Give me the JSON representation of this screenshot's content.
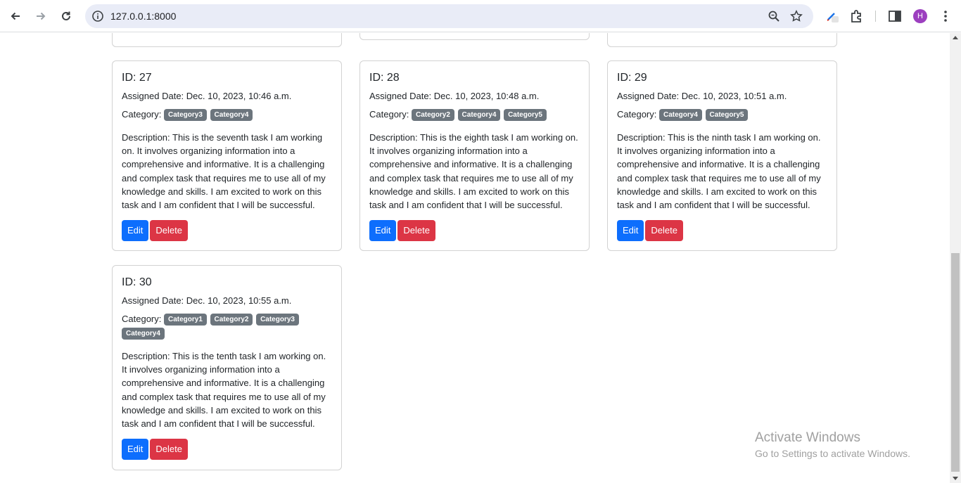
{
  "browser": {
    "url": "127.0.0.1:8000",
    "profile_initial": "H"
  },
  "cards": [
    {
      "id": "ID: 27",
      "date": "Assigned Date: Dec. 10, 2023, 10:46 a.m.",
      "category_label": "Category:",
      "categories": [
        "Category3",
        "Category4"
      ],
      "description": "Description: This is the seventh task I am working on. It involves organizing information into a comprehensive and informative. It is a challenging and complex task that requires me to use all of my knowledge and skills. I am excited to work on this task and I am confident that I will be successful.",
      "edit_label": "Edit",
      "delete_label": "Delete"
    },
    {
      "id": "ID: 28",
      "date": "Assigned Date: Dec. 10, 2023, 10:48 a.m.",
      "category_label": "Category:",
      "categories": [
        "Category2",
        "Category4",
        "Category5"
      ],
      "description": "Description: This is the eighth task I am working on. It involves organizing information into a comprehensive and informative. It is a challenging and complex task that requires me to use all of my knowledge and skills. I am excited to work on this task and I am confident that I will be successful.",
      "edit_label": "Edit",
      "delete_label": "Delete"
    },
    {
      "id": "ID: 29",
      "date": "Assigned Date: Dec. 10, 2023, 10:51 a.m.",
      "category_label": "Category:",
      "categories": [
        "Category4",
        "Category5"
      ],
      "description": "Description: This is the ninth task I am working on. It involves organizing information into a comprehensive and informative. It is a challenging and complex task that requires me to use all of my knowledge and skills. I am excited to work on this task and I am confident that I will be successful.",
      "edit_label": "Edit",
      "delete_label": "Delete"
    },
    {
      "id": "ID: 30",
      "date": "Assigned Date: Dec. 10, 2023, 10:55 a.m.",
      "category_label": "Category:",
      "categories": [
        "Category1",
        "Category2",
        "Category3",
        "Category4"
      ],
      "description": "Description: This is the tenth task I am working on. It involves organizing information into a comprehensive and informative. It is a challenging and complex task that requires me to use all of my knowledge and skills. I am excited to work on this task and I am confident that I will be successful.",
      "edit_label": "Edit",
      "delete_label": "Delete"
    }
  ],
  "watermark": {
    "line1": "Activate Windows",
    "line2": "Go to Settings to activate Windows."
  },
  "colors": {
    "primary": "#0d6efd",
    "danger": "#dc3545",
    "badge": "#6c757d"
  }
}
